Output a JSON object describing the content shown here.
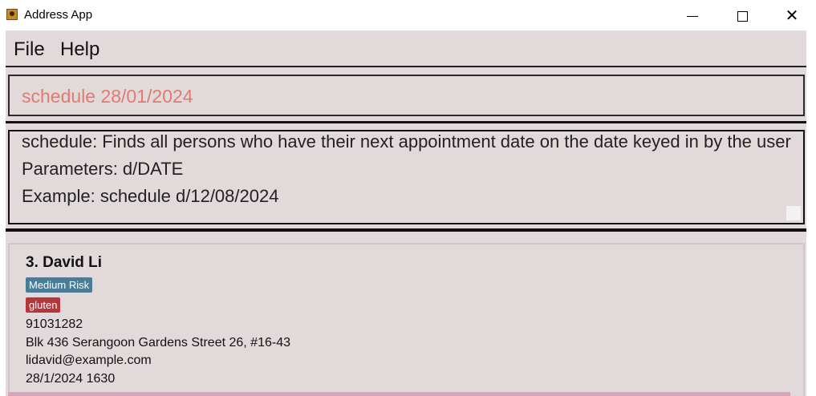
{
  "window": {
    "title": "Address App",
    "icon": "address-book-icon"
  },
  "menu": {
    "file": "File",
    "help": "Help"
  },
  "command": {
    "value": "schedule 28/01/2024",
    "text_color": "#e07b70"
  },
  "result": {
    "line1": "schedule: Finds all persons who have their next appointment date on the date keyed in by the user",
    "line2": "Parameters: d/DATE",
    "line3": "Example: schedule d/12/08/2024"
  },
  "person": {
    "index_name": "3. David Li",
    "tags": {
      "risk": "Medium Risk",
      "allergy": "gluten"
    },
    "phone": "91031282",
    "address": "Blk 436 Serangoon Gardens Street 26, #16-43",
    "email": "lidavid@example.com",
    "appointment": "28/1/2024 1630"
  },
  "colors": {
    "background": "#e2dada",
    "risk_tag": "#4a7c96",
    "allergy_tag": "#b5363b",
    "selection_bar": "#d9a3ba"
  }
}
